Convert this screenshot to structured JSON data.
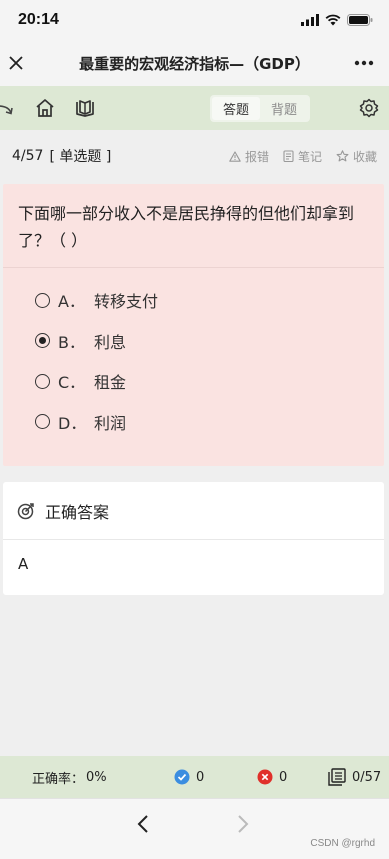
{
  "status_bar": {
    "time": "20:14"
  },
  "nav": {
    "title": "最重要的宏观经济指标—（GDP）"
  },
  "toolbar": {
    "mode_tabs": [
      {
        "label": "答题",
        "active": true
      },
      {
        "label": "背题",
        "active": false
      }
    ]
  },
  "question_info": {
    "progress": "4/57",
    "type": "[ 单选题 ]",
    "actions": {
      "report": "报错",
      "note": "笔记",
      "favorite": "收藏"
    }
  },
  "question": {
    "text": "下面哪一部分收入不是居民挣得的但他们却拿到了？（ ）",
    "options": [
      {
        "letter": "A．",
        "text": "转移支付",
        "selected": false
      },
      {
        "letter": "B．",
        "text": "利息",
        "selected": true
      },
      {
        "letter": "C．",
        "text": "租金",
        "selected": false
      },
      {
        "letter": "D．",
        "text": "利润",
        "selected": false
      }
    ]
  },
  "answer": {
    "heading": "正确答案",
    "value": "A"
  },
  "stats": {
    "accuracy_label": "正确率：",
    "accuracy_value": "0%",
    "correct_count": "0",
    "wrong_count": "0",
    "answered": "0/57"
  },
  "watermark": "CSDN @rgrhd",
  "colors": {
    "toolbar_bg": "#dde8d4",
    "question_bg": "#fae3e1",
    "correct": "#3b8de0",
    "wrong": "#e0302a"
  }
}
